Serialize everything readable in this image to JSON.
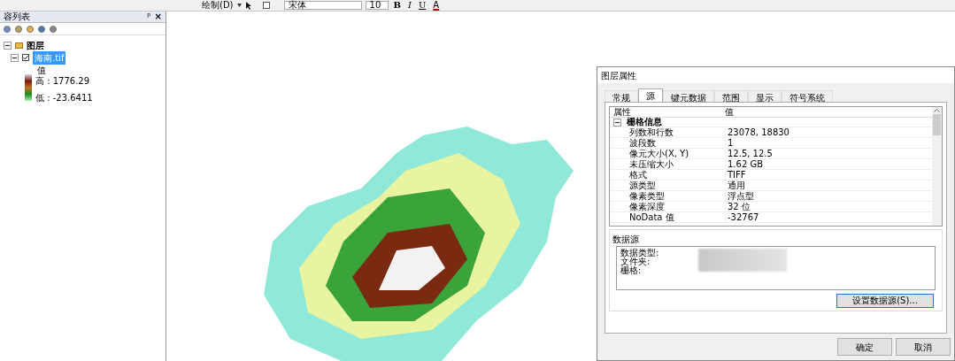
{
  "toolbar": {
    "draw_menu": "绘制(D)",
    "font": "宋体",
    "font_size": "10",
    "bold": "B",
    "italic": "I",
    "underline": "U",
    "text_color": "A"
  },
  "toc": {
    "title": "容列表",
    "pin": "ᵖ",
    "close": "×",
    "tree": [
      {
        "label": "图层",
        "expanded": true,
        "children": [
          {
            "label": "海南.tif",
            "checked": true,
            "selected": true,
            "expanded": true,
            "legend": {
              "title": "值",
              "high": "高 : 1776.29",
              "low": "低 : -23.6411"
            }
          }
        ]
      }
    ]
  },
  "dialog": {
    "title": "图层属性",
    "tabs": [
      {
        "label": "常规",
        "selected": false
      },
      {
        "label": "源",
        "selected": true
      },
      {
        "label": "键元数据",
        "selected": false
      },
      {
        "label": "范围",
        "selected": false
      },
      {
        "label": "显示",
        "selected": false
      },
      {
        "label": "符号系统",
        "selected": false
      }
    ],
    "table": {
      "columns": [
        "属性",
        "值"
      ],
      "group": {
        "label": "栅格信息",
        "expanded": true
      },
      "rows": [
        [
          "列数和行数",
          "23078, 18830"
        ],
        [
          "波段数",
          "1"
        ],
        [
          "像元大小(X, Y)",
          "12.5, 12.5"
        ],
        [
          "未压缩大小",
          "1.62 GB"
        ],
        [
          "格式",
          "TIFF"
        ],
        [
          "源类型",
          "通用"
        ],
        [
          "像素类型",
          "浮点型"
        ],
        [
          "像素深度",
          "32 位"
        ],
        [
          "NoData 值",
          "-32767"
        ]
      ]
    },
    "data_source": {
      "title": "数据源",
      "labels": [
        "数据类型:",
        "文件夹:",
        "栅格:"
      ]
    },
    "set_source_button": "设置数据源(S)...",
    "buttons": [
      "确定",
      "取消"
    ]
  }
}
